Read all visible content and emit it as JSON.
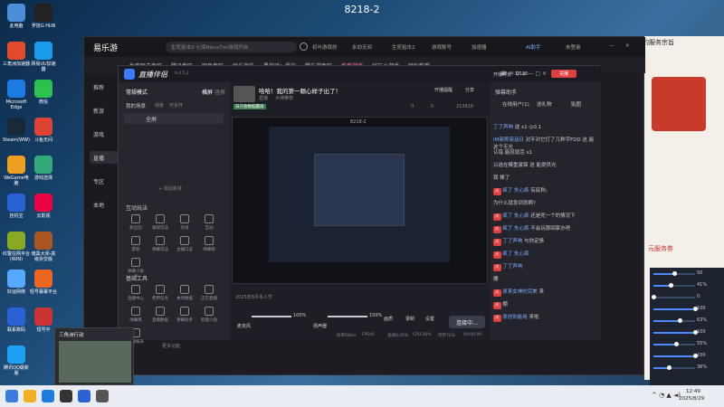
{
  "window_title": "8218-2",
  "desktop_icons": [
    {
      "label": "此电脑",
      "color": "#4a8fd8"
    },
    {
      "label": "罗技G HUB",
      "color": "#222"
    },
    {
      "label": "三角洲加速器",
      "color": "#e24c2c"
    },
    {
      "label": "网易UU加速器",
      "color": "#1a9be8"
    },
    {
      "label": "Microsoft Edge",
      "color": "#1c7be0"
    },
    {
      "label": "微信",
      "color": "#2dc14e"
    },
    {
      "label": "Steam(WW)",
      "color": "#1b2838"
    },
    {
      "label": "斗鱼无间",
      "color": "#d43"
    },
    {
      "label": "WeGame电脑",
      "color": "#f0a020"
    },
    {
      "label": "游戏选择",
      "color": "#3a7"
    },
    {
      "label": "挂机宝",
      "color": "#2a62d6"
    },
    {
      "label": "云影视",
      "color": "#e04"
    },
    {
      "label": "红警在网平台(WIN)",
      "color": "#8a2"
    },
    {
      "label": "暗黑大师-高级杂交版",
      "color": "#a52"
    },
    {
      "label": "好运网络",
      "color": "#5af"
    },
    {
      "label": "轻号幕幕平台",
      "color": "#e62"
    },
    {
      "label": "联系数码",
      "color": "#2a62d6"
    },
    {
      "label": "短号平",
      "color": "#c33"
    },
    {
      "label": "腾讯QQ最新版",
      "color": "#1da1f2"
    }
  ],
  "app": {
    "brand": "易乐游",
    "search_placeholder": "生死狙击2-七海Nana7mi游戏开启",
    "top_links": [
      "初叶游戏创",
      "永劫无间",
      "生死狙击2",
      "游戏账号",
      "加速器"
    ],
    "ai_label": "AI助手",
    "login_label": "未登录",
    "nav_tabs": [
      "生死狙击专区",
      "腾讯专区",
      "网易专区",
      "娱乐竞技",
      "黑神话：悟空",
      "腾乐游专区",
      "推荐游戏",
      "好玩小游戏",
      "特别推荐"
    ],
    "active_nav": "推荐游戏",
    "side_items": [
      "推荐",
      "新游",
      "游戏",
      "直播",
      "专区",
      "本地"
    ]
  },
  "right_panel": {
    "text": "的服务宗旨",
    "promo": "元服务券"
  },
  "mixer": {
    "levels": [
      {
        "label": "50",
        "value": 50
      },
      {
        "label": "41%",
        "value": 41
      },
      {
        "label": "0",
        "value": 0
      },
      {
        "label": "100",
        "value": 100
      },
      {
        "label": "63%",
        "value": 63
      },
      {
        "label": "100",
        "value": 100
      },
      {
        "label": "55%",
        "value": 55
      },
      {
        "label": "100",
        "value": 100
      },
      {
        "label": "36%",
        "value": 36
      }
    ]
  },
  "companion": {
    "title": "直播伴侣",
    "version": "6.4.5.2",
    "mode_label": "常规模式",
    "landscape": "横屏",
    "portrait": "竖屏",
    "my_scenes": "我的场景",
    "scene_tab": "场景",
    "source_tab": "可多开",
    "scene_item": "全屏",
    "add_material": "+ 添加素材",
    "interact_title": "互动玩法",
    "interact_tools": [
      "粉丝团",
      "福袋玩法",
      "连线",
      "互动",
      "游戏",
      "弹幕玩法",
      "主播口说",
      "弹幕赠",
      "弹幕小助手"
    ],
    "basic_title": "基础工具",
    "basic_tools": [
      "直播中心",
      "使用任务",
      "本场数据",
      "正在直播",
      "弹幕库",
      "直播数据",
      "弹幕助手",
      "智能小助",
      "下播报表"
    ],
    "more": "更多功能",
    "stream_title": "哈哈！我的第一颗心样子出了！",
    "stream_tags": [
      "直播",
      "大神推荐"
    ],
    "badge": "日只会数据赢排",
    "stream_stats": {
      "comments": "0",
      "likes": "213816",
      "fans": "0"
    },
    "top_right": [
      "开播提醒",
      "分享"
    ],
    "audio": [
      {
        "label": "麦克风",
        "value": "100%"
      },
      {
        "label": "扬声器",
        "value": "100%"
      }
    ],
    "bottom_tools": [
      "画质",
      "录制",
      "设置"
    ],
    "connect_label": "连接中...",
    "status_bar": {
      "rate": "码率0Kb/s",
      "fps": "FPS40",
      "drop": "丢帧0.00%",
      "cpu": "CPU:36%",
      "mem": "内存72%",
      "live_time": "00:00:00"
    },
    "hint": "2025年8月本人节"
  },
  "chat": {
    "header": "弹幕助手",
    "online": "在线用户(1)",
    "tabs": [
      "在线用户(1)",
      "送礼物",
      "贴图"
    ],
    "topbar": [
      "开播时长",
      "1/120"
    ],
    "close_label": "关播",
    "messages": [
      {
        "tag": "",
        "user": "丁了声响",
        "text": "送 x1 ◎0.1"
      },
      {
        "tag": "",
        "user": "IM简称简话日",
        "text": "对不对它打了几种字FDD 这 能这个无光"
      },
      {
        "tag": "",
        "user": "",
        "text": "认错 能就就活 x1"
      },
      {
        "tag": "",
        "user": "",
        "text": "以选在模重激锦 送 能提供光"
      },
      {
        "tag": "",
        "user": "",
        "text": "我 棒了"
      },
      {
        "tag": "火",
        "user": "疯了 失心疯",
        "text": "有底狗。"
      },
      {
        "tag": "",
        "user": "",
        "text": "为什么就急到就啊?"
      },
      {
        "tag": "火",
        "user": "疯了 失心疯",
        "text": "还是死一个的情况下"
      },
      {
        "tag": "火",
        "user": "疯了 失心疯",
        "text": "不会玩那回家办吧"
      },
      {
        "tag": "火",
        "user": "丁了声响",
        "text": "与你定情"
      },
      {
        "tag": "火",
        "user": "疯了 失心疯",
        "text": ""
      },
      {
        "tag": "火",
        "user": "丁了声响",
        "text": ""
      },
      {
        "tag": "",
        "user": "",
        "text": "棚"
      },
      {
        "tag": "火",
        "user": "原来女神的完美",
        "text": "来"
      },
      {
        "tag": "火",
        "user": "",
        "text": "棚"
      },
      {
        "tag": "火",
        "user": "原创你能用",
        "text": "来啦"
      }
    ],
    "footer_hint": "如何学播 "
  },
  "popup": {
    "title": "三角洲行动"
  },
  "taskbar": {
    "time": "12:49",
    "date": "2025/8/29"
  }
}
